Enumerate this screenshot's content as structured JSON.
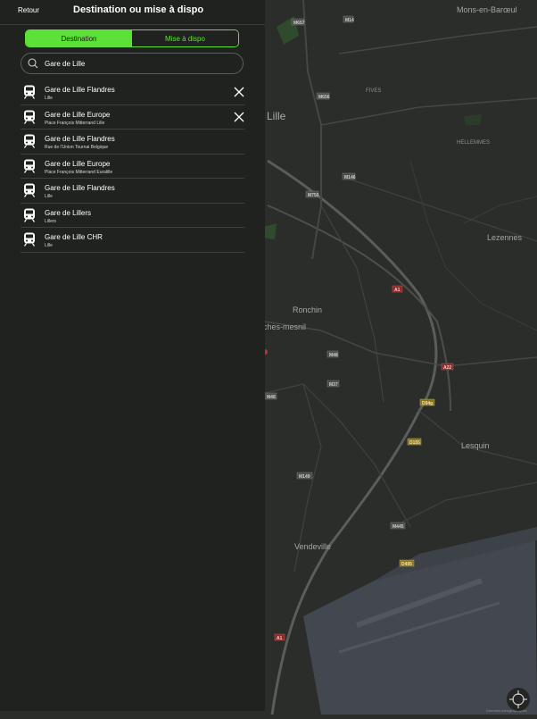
{
  "header": {
    "back_label": "Retour",
    "title": "Destination ou mise à dispo"
  },
  "segmented": {
    "options": [
      "Destination",
      "Mise à dispo"
    ],
    "selected": "Destination"
  },
  "search": {
    "value": "Gare de Lille",
    "icon": "search-icon"
  },
  "results": [
    {
      "name": "Gare de Lille Flandres",
      "sub": "Lille",
      "removable": true,
      "icon": "train-icon"
    },
    {
      "name": "Gare de Lille Europe",
      "sub": "Place François Mitterrand Lille",
      "removable": true,
      "icon": "train-icon"
    },
    {
      "name": "Gare de Lille Flandres",
      "sub": "Rue de l'Union Tournai Belgique",
      "removable": false,
      "icon": "train-icon"
    },
    {
      "name": "Gare de Lille Europe",
      "sub": "Place François Mitterrand Euralille",
      "removable": false,
      "icon": "train-icon"
    },
    {
      "name": "Gare de Lille Flandres",
      "sub": "Lille",
      "removable": false,
      "icon": "train-icon"
    },
    {
      "name": "Gare de Lillers",
      "sub": "Lillers",
      "removable": false,
      "icon": "train-icon"
    },
    {
      "name": "Gare de Lille CHR",
      "sub": "Lille",
      "removable": false,
      "icon": "train-icon"
    }
  ],
  "map": {
    "places": [
      "Lille",
      "Mons-en-Barœul",
      "FIVES",
      "HELLEMMES",
      "Lezennes",
      "Ronchin",
      "ches-mesnil",
      "Lesquin",
      "Vendeville"
    ],
    "roads": [
      "M657",
      "M14",
      "M656",
      "M146",
      "M750",
      "A1",
      "M48",
      "A22",
      "M37",
      "M48",
      "D94g",
      "D155",
      "M149",
      "M445",
      "D495",
      "A1"
    ],
    "attribution": "Données cartographiques"
  },
  "colors": {
    "accent": "#5de038",
    "panel": "#202220",
    "map": "#2b2d2b"
  },
  "locate_icon": "crosshair-icon"
}
